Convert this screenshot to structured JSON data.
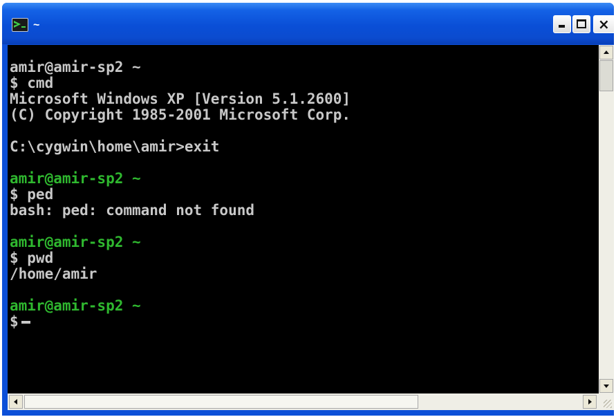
{
  "window": {
    "title": "~",
    "icon": "terminal-app-icon",
    "titlebar_color": "#0a4fd7"
  },
  "titlebar_buttons": {
    "minimize_icon": "minimize-icon",
    "maximize_icon": "maximize-icon",
    "close_icon": "close-icon",
    "close_glyph": "×"
  },
  "console": {
    "background": "#000000",
    "text_color": "#c8c8c8",
    "prompt_color": "#2fb82f",
    "lines": [
      {
        "text": "amir@amir-sp2 ~",
        "style": "plain"
      },
      {
        "text": "$ cmd",
        "style": "plain"
      },
      {
        "text": "Microsoft Windows XP [Version 5.1.2600]",
        "style": "plain"
      },
      {
        "text": "(C) Copyright 1985-2001 Microsoft Corp.",
        "style": "plain"
      },
      {
        "text": "",
        "style": "plain"
      },
      {
        "text": "C:\\cygwin\\home\\amir>exit",
        "style": "plain"
      },
      {
        "text": "",
        "style": "plain"
      },
      {
        "text": "amir@amir-sp2 ~",
        "style": "green"
      },
      {
        "text": "$ ped",
        "style": "plain"
      },
      {
        "text": "bash: ped: command not found",
        "style": "plain"
      },
      {
        "text": "",
        "style": "plain"
      },
      {
        "text": "amir@amir-sp2 ~",
        "style": "green"
      },
      {
        "text": "$ pwd",
        "style": "plain"
      },
      {
        "text": "/home/amir",
        "style": "plain"
      },
      {
        "text": "",
        "style": "plain"
      },
      {
        "text": "amir@amir-sp2 ~",
        "style": "green"
      },
      {
        "text": "$",
        "style": "plain"
      }
    ]
  },
  "scrollbars": {
    "up_icon": "arrow-up-icon",
    "down_icon": "arrow-down-icon",
    "left_icon": "arrow-left-icon",
    "right_icon": "arrow-right-icon"
  }
}
